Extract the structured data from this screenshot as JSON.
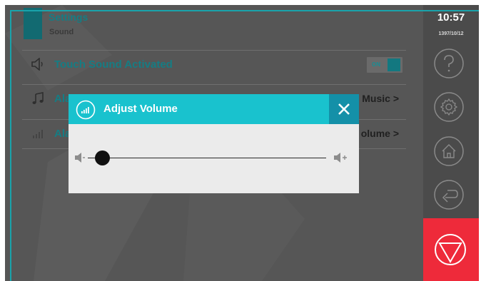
{
  "header": {
    "title": "Settings",
    "subtitle": "Sound"
  },
  "rows": [
    {
      "label": "Touch Sound Activated",
      "icon": "speaker-icon",
      "toggle": "ON"
    },
    {
      "label": "Ala",
      "icon": "music-note-icon",
      "value": "Music >"
    },
    {
      "label": "Ala",
      "icon": "volume-bars-icon",
      "value": "olume >"
    }
  ],
  "side": {
    "time": "10:57",
    "date": "1397/10/12",
    "buttons": [
      "help-icon",
      "gear-icon",
      "home-icon",
      "back-icon"
    ],
    "stop": "stop-icon"
  },
  "dialog": {
    "title": "Adjust Volume",
    "icon": "volume-bars-icon",
    "close": "close-icon",
    "volume_level": 0.03
  },
  "colors": {
    "accent": "#19c2ce",
    "dark_accent": "#157d84",
    "stop": "#ee2a3a",
    "overlay": "#565656"
  }
}
